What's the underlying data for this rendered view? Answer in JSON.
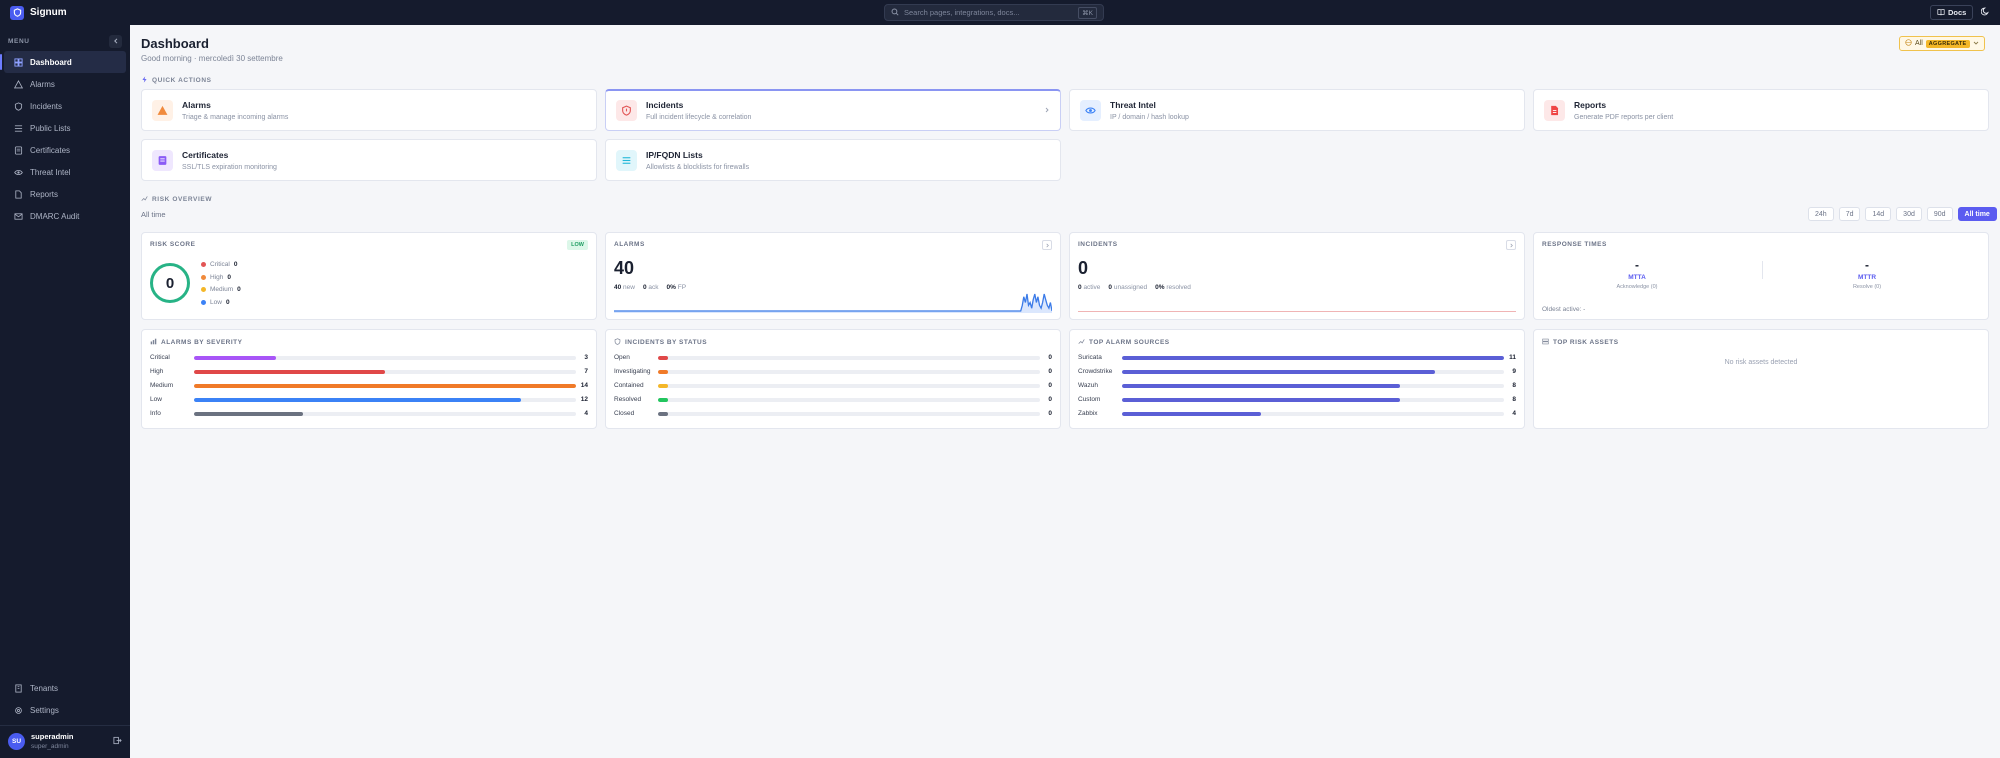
{
  "app": {
    "name": "Signum"
  },
  "search": {
    "placeholder": "Search pages, integrations, docs...",
    "shortcut": "⌘K"
  },
  "header_actions": {
    "docs_label": "Docs"
  },
  "sidebar": {
    "menu_label": "MENU",
    "items": [
      {
        "label": "Dashboard",
        "icon": "dashboard-icon",
        "active": true
      },
      {
        "label": "Alarms",
        "icon": "alarm-icon"
      },
      {
        "label": "Incidents",
        "icon": "shield-icon"
      },
      {
        "label": "Public Lists",
        "icon": "list-icon"
      },
      {
        "label": "Certificates",
        "icon": "certificate-icon"
      },
      {
        "label": "Threat Intel",
        "icon": "eye-icon"
      },
      {
        "label": "Reports",
        "icon": "file-icon"
      },
      {
        "label": "DMARC Audit",
        "icon": "mail-icon"
      }
    ],
    "bottom_items": [
      {
        "label": "Tenants",
        "icon": "building-icon"
      },
      {
        "label": "Settings",
        "icon": "gear-icon"
      }
    ],
    "user": {
      "initials": "SU",
      "name": "superadmin",
      "role": "super_admin"
    }
  },
  "page": {
    "title": "Dashboard",
    "greeting": "Good morning · mercoledì 30 settembre",
    "scope": {
      "label": "All",
      "badge": "AGGREGATE"
    }
  },
  "quick_actions": {
    "label": "QUICK ACTIONS",
    "items": [
      {
        "title": "Alarms",
        "subtitle": "Triage & manage incoming alarms",
        "icon": "warning-icon",
        "color": "#f08a3c"
      },
      {
        "title": "Incidents",
        "subtitle": "Full incident lifecycle & correlation",
        "icon": "shield-icon",
        "color": "#e25555"
      },
      {
        "title": "Threat Intel",
        "subtitle": "IP / domain / hash lookup",
        "icon": "eye-icon",
        "color": "#3b82f6"
      },
      {
        "title": "Reports",
        "subtitle": "Generate PDF reports per client",
        "icon": "file-icon",
        "color": "#ef4444"
      },
      {
        "title": "Certificates",
        "subtitle": "SSL/TLS expiration monitoring",
        "icon": "certificate-icon",
        "color": "#8b5cf6"
      },
      {
        "title": "IP/FQDN Lists",
        "subtitle": "Allowlists & blocklists for firewalls",
        "icon": "list-icon",
        "color": "#22b8d8"
      }
    ]
  },
  "risk_overview": {
    "label": "RISK OVERVIEW",
    "period_label": "All time",
    "ranges": [
      "24h",
      "7d",
      "14d",
      "30d",
      "90d",
      "All time"
    ],
    "active_range": "All time"
  },
  "risk_score": {
    "title": "RISK SCORE",
    "badge": "LOW",
    "value": "0",
    "levels": [
      {
        "label": "Critical",
        "value": "0",
        "color": "#e25555"
      },
      {
        "label": "High",
        "value": "0",
        "color": "#f08a3c"
      },
      {
        "label": "Medium",
        "value": "0",
        "color": "#f4b728"
      },
      {
        "label": "Low",
        "value": "0",
        "color": "#3b82f6"
      }
    ]
  },
  "alarms_card": {
    "title": "ALARMS",
    "value": "40",
    "stats": [
      {
        "value": "40",
        "label": "new"
      },
      {
        "value": "0",
        "label": "ack"
      },
      {
        "value": "0%",
        "label": "FP"
      }
    ],
    "sparkline": [
      0,
      0,
      0,
      0,
      0,
      0,
      0,
      0,
      0,
      0,
      0,
      0,
      0,
      0,
      0,
      0,
      0,
      0,
      0,
      0,
      0,
      0,
      0,
      0,
      0,
      0,
      0,
      0,
      0,
      0,
      0,
      0,
      0,
      0,
      0,
      0,
      0,
      0,
      0,
      0,
      0,
      0,
      0,
      0,
      0,
      0,
      0,
      0,
      0,
      0,
      0,
      0,
      0,
      0,
      0,
      0,
      0,
      0,
      0,
      0,
      0,
      0,
      0,
      0,
      0,
      0,
      0,
      0,
      0,
      0,
      0,
      0,
      0,
      0,
      0,
      0,
      0,
      0,
      0,
      0,
      0,
      0,
      0,
      0,
      0,
      0,
      0,
      0,
      0,
      0,
      0,
      0,
      0,
      0,
      0,
      0,
      0,
      0,
      0,
      0,
      0,
      0,
      0,
      0,
      0,
      0,
      0,
      0,
      0,
      0,
      0,
      0,
      0,
      0,
      0,
      0,
      0,
      0,
      0,
      0,
      0,
      0,
      0,
      0,
      0,
      0,
      0,
      0,
      0,
      0,
      0,
      0,
      0,
      0,
      0,
      0,
      0,
      0,
      0,
      0,
      0,
      0,
      0,
      0,
      0,
      0,
      0,
      0,
      0,
      0,
      0,
      0,
      0,
      0,
      0,
      0,
      0,
      0,
      0,
      0,
      0,
      0,
      0,
      0,
      0,
      0,
      0,
      0,
      0,
      0,
      0,
      0,
      0,
      0,
      0,
      0,
      0,
      0,
      0,
      0,
      0,
      0,
      0,
      0,
      0,
      0,
      0,
      0,
      0,
      0,
      0,
      0,
      0,
      0,
      0,
      0,
      0,
      0,
      0,
      0,
      0,
      0,
      0,
      0,
      0,
      0,
      0,
      0,
      0,
      0,
      0,
      0,
      0,
      0,
      0,
      0,
      0,
      0,
      0,
      0,
      0,
      0,
      0,
      0,
      0,
      0,
      0,
      0,
      0,
      0,
      0,
      0,
      0,
      0,
      0,
      0,
      0,
      0,
      0,
      0,
      0,
      0,
      0,
      0,
      0,
      0,
      0,
      0,
      0,
      0,
      0,
      0,
      0,
      0,
      0,
      0,
      0,
      0,
      0,
      0,
      0,
      2,
      5,
      3,
      6,
      2,
      3,
      1,
      4,
      6,
      3,
      5,
      2,
      1,
      3,
      6,
      4,
      2,
      1,
      3,
      0
    ]
  },
  "incidents_card": {
    "title": "INCIDENTS",
    "value": "0",
    "stats": [
      {
        "value": "0",
        "label": "active"
      },
      {
        "value": "0",
        "label": "unassigned"
      },
      {
        "value": "0%",
        "label": "resolved"
      }
    ]
  },
  "response_times": {
    "title": "RESPONSE TIMES",
    "metrics": [
      {
        "value": "-",
        "label": "MTTA",
        "sub": "Acknowledge (0)"
      },
      {
        "value": "-",
        "label": "MTTR",
        "sub": "Resolve (0)"
      }
    ],
    "oldest": "Oldest active: -"
  },
  "alarms_by_severity": {
    "title": "ALARMS BY SEVERITY",
    "max": 14,
    "rows": [
      {
        "label": "Critical",
        "value": 3,
        "color": "#a855f7"
      },
      {
        "label": "High",
        "value": 7,
        "color": "#e04848"
      },
      {
        "label": "Medium",
        "value": 14,
        "color": "#f07a28"
      },
      {
        "label": "Low",
        "value": 12,
        "color": "#3b82f6"
      },
      {
        "label": "Info",
        "value": 4,
        "color": "#6b7280"
      }
    ]
  },
  "incidents_by_status": {
    "title": "INCIDENTS BY STATUS",
    "rows": [
      {
        "label": "Open",
        "value": 0,
        "color": "#e04848"
      },
      {
        "label": "Investigating",
        "value": 0,
        "color": "#f07a28"
      },
      {
        "label": "Contained",
        "value": 0,
        "color": "#f4b728"
      },
      {
        "label": "Resolved",
        "value": 0,
        "color": "#22c55e"
      },
      {
        "label": "Closed",
        "value": 0,
        "color": "#6b7280"
      }
    ]
  },
  "top_alarm_sources": {
    "title": "TOP ALARM SOURCES",
    "max": 11,
    "color": "#5b5fd6",
    "rows": [
      {
        "label": "Suricata",
        "value": 11
      },
      {
        "label": "Crowdstrike",
        "value": 9
      },
      {
        "label": "Wazuh",
        "value": 8
      },
      {
        "label": "Custom",
        "value": 8
      },
      {
        "label": "Zabbix",
        "value": 4
      }
    ]
  },
  "top_risk_assets": {
    "title": "TOP RISK ASSETS",
    "empty": "No risk assets detected"
  }
}
